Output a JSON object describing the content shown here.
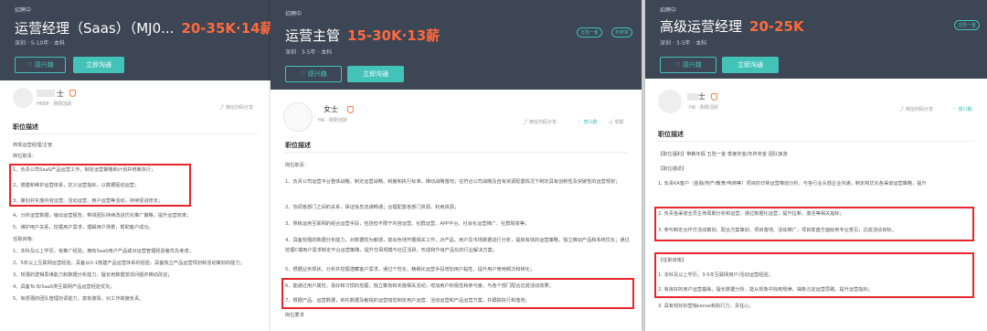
{
  "card1": {
    "status": "招聘中",
    "title": "运营经理（Saas）（MJ0...",
    "salary": "20-35K·14薪",
    "meta": "深圳 · 5-10年 · 本科",
    "interest_label": "♡ 感兴趣",
    "chat_label": "立即沟通",
    "recruiter_name": "士",
    "recruiter_sub": "HRBP · 刚刚活跃",
    "share_label": "微信扫码分享",
    "section_title": "职位描述",
    "lines": [
      "简现运营经理/主管",
      "岗位职责：",
      "1、负责公司SaaS产品运营工作，制定运营策略和计划并统筹执行；",
      "2、搭建和维护运营体系，定义运营指标，以数据驱动运营；",
      "3、策划并实施内容运营、活动运营、用户运营等活动，持续促进增长；",
      "4、分析运营数据，输出运营报告，带领团队持续改进优化推广策略，提升运营效率；",
      "5、维护用户关系，挖掘用户需求，理解用户场景，帮助客户成功。",
      "任职资格：",
      "1、本科及以上学历，有推广经验，拥有SaaS用户产品或对运营管理经验者优先考虑；",
      "2、5年以上互联网运营经验，具备从0-1搭建产品运营体系的经验，具备独立产品运营规划和活动策划的能力；",
      "3、较强的逻辑思维能力和数据分析能力，擅长用数据发现问题并推动改进；",
      "4、具备To B/SaaS类互联网产品运营经验优先；",
      "5、有很强的团队管理协调能力，富有激情，对工作高度负责。"
    ]
  },
  "card2": {
    "status": "招聘中",
    "title": "运营主管",
    "salary": "15-30K·13薪",
    "meta": "深圳 · 3-5年 · 本科",
    "tags": [
      "五险一金",
      "年终奖"
    ],
    "interest_label": "♡ 感兴趣",
    "chat_label": "立即沟通",
    "recruiter_name": "女士",
    "recruiter_sub": "HR · 刚刚活跃",
    "share_label": "微信扫码分享",
    "fav_label": "感兴趣",
    "report_label": "举报",
    "section_title": "职位描述",
    "lines": [
      "岗位职责：",
      "1、负责公司运营平台整体战略、制定运营战略、制度和执行标准，推动战略落地；在符合公司战略及自有资源配置情况下制定具有创新性及突破性的运营规划；",
      "2、协调各部门之间的关系，保证信息流通畅通；合理配置各部门资源，利用资源；",
      "3、熟练运用互联网的组合运营手段，包括但不限于内容运营、社群运营、APP平台、社会化运营推广、社群裂变等；",
      "4、具备较强的数据分析能力，对数据较为敏感，能出色地开展相关工作，对产品、用户及市场数据进行分析，提炼有效的运营策略，独立推动产品和系统优化；通过挖掘C端用户需求制定平台运营策略，提升交易规模与社区活跃，形成和升级产品化的行业解决方案；",
      "5、根据业务现状，分析并挖掘潜藏客户需求，通过个性化、精细化运营手段增加用户黏性，提升用户使用频次和转化；",
      "6、能通过用户属性、喜好和习惯的挖掘，独立策划和实施相关活动，增加用户积极性和参与度，与各个部门配合达成活动效果；",
      "7、根据产品、运营数据，依托数据及敏锐的运营嗅觉制定用户运营、活动运营和产品运营方案，并跟踪执行和落地。",
      "岗位要求"
    ]
  },
  "card3": {
    "status": "招聘中",
    "title": "高级运营经理",
    "salary": "20-25K",
    "meta": "深圳 · 3-5年 · 本科",
    "tags": [
      "五险一金"
    ],
    "interest_label": "♡ 感兴趣",
    "chat_label": "立即沟通",
    "recruiter_name": "士",
    "recruiter_sub": "HR · 刚刚活跃",
    "share_label": "微信扫码分享",
    "fav_label": "感兴趣",
    "section_title": "职位描述",
    "lines": [
      "【职位福利】带薪年假 五险一金 季度奖金/年终奖金 团队旅游",
      "【职位描述】",
      "1. 负责KA客户（金融/地产/教育/电商等）项目的日常运营推动分析，与各行业头部企业沟通，制定和优化各渠道运营策略，提升",
      "2. 负责各渠道全员生命周期分析和运营，通过数据化运营，提升拉新、激活等相关指标；",
      "3. 参与制定合作方活动策划，配合方案策划、项目落地、活动推广，项目复盘方面给到专业意见，达成活动目标。",
      "【任职资格】",
      "1. 本科及以上学历，3-5年互联网用户/活动运营经验；",
      "2. 有良好的用户运营基础，擅长数据分析，能从现象中找到规律，抽象沉淀运营思路，提升运营指标；",
      "3. 具有较好的营销sense和执行力、责任心。"
    ]
  }
}
